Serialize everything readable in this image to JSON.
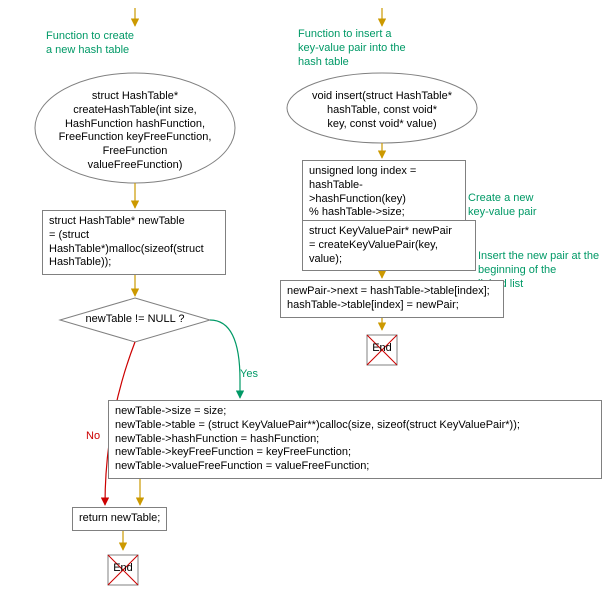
{
  "left": {
    "title": "Function to create\na new hash table",
    "start": "struct HashTable*\ncreateHashTable(int size,\nHashFunction hashFunction,\nFreeFunction keyFreeFunction,\nFreeFunction\nvalueFreeFunction)",
    "box1": "struct HashTable* newTable\n= (struct\nHashTable*)malloc(sizeof(struct\nHashTable));",
    "decision": "newTable != NULL ?",
    "yes": "Yes",
    "no": "No",
    "box2": "newTable->size = size;\nnewTable->table = (struct KeyValuePair**)calloc(size, sizeof(struct KeyValuePair*));\nnewTable->hashFunction = hashFunction;\nnewTable->keyFreeFunction = keyFreeFunction;\nnewTable->valueFreeFunction = valueFreeFunction;",
    "return": "return newTable;",
    "end": "End"
  },
  "right": {
    "title": "Function to insert a\nkey-value pair into the\nhash table",
    "start": "void insert(struct HashTable*\nhashTable, const void*\nkey, const void* value)",
    "box1": "unsigned long index =\nhashTable->hashFunction(key)\n% hashTable->size;",
    "label1": "Create a new\nkey-value pair",
    "box2": "struct KeyValuePair* newPair\n= createKeyValuePair(key,\nvalue);",
    "label2": "Insert the new pair at the\nbeginning of the\nlinked list",
    "box3": "newPair->next = hashTable->table[index];\nhashTable->table[index] = newPair;",
    "end": "End"
  }
}
